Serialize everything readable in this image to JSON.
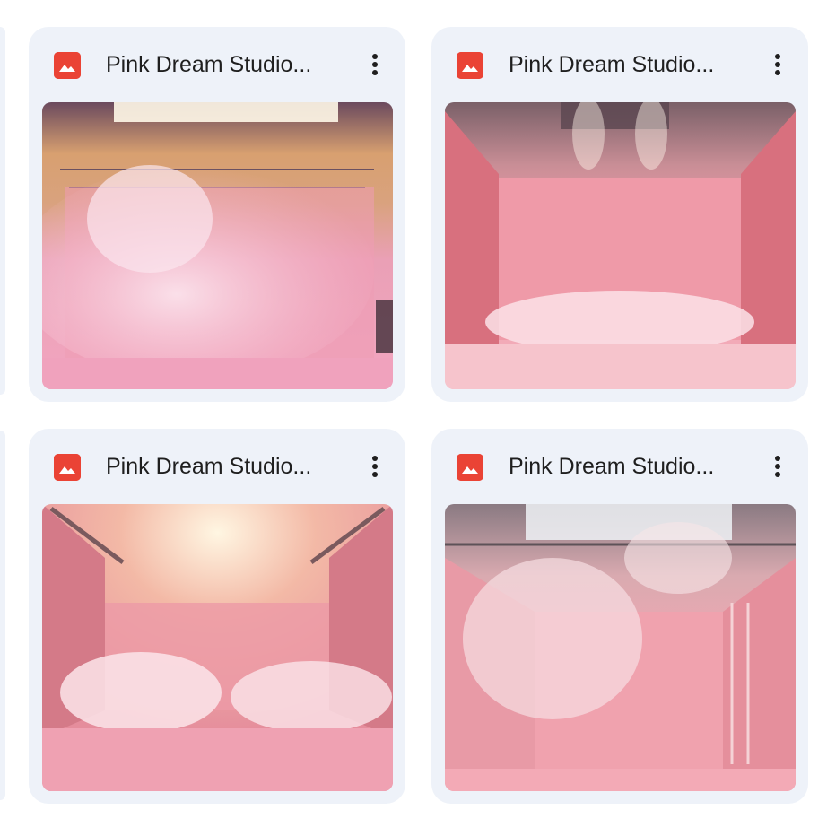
{
  "grid": {
    "items": [
      {
        "title": "Pink Dream Studio...",
        "file_type_icon": "image-file-icon",
        "more_icon": "more-vert-icon",
        "thumbnail": "pink-studio-smoke-skylight"
      },
      {
        "title": "Pink Dream Studio...",
        "file_type_icon": "image-file-icon",
        "more_icon": "more-vert-icon",
        "thumbnail": "pink-studio-curtains-spotlights"
      },
      {
        "title": "Pink Dream Studio...",
        "file_type_icon": "image-file-icon",
        "more_icon": "more-vert-icon",
        "thumbnail": "pink-studio-truss-glitter"
      },
      {
        "title": "Pink Dream Studio...",
        "file_type_icon": "image-file-icon",
        "more_icon": "more-vert-icon",
        "thumbnail": "pink-studio-cyclorama-ladder"
      }
    ]
  },
  "colors": {
    "card_background": "#eef2f9",
    "image_icon": "#ea4335",
    "title_text": "#1f1f1f",
    "page_background": "#ffffff"
  }
}
